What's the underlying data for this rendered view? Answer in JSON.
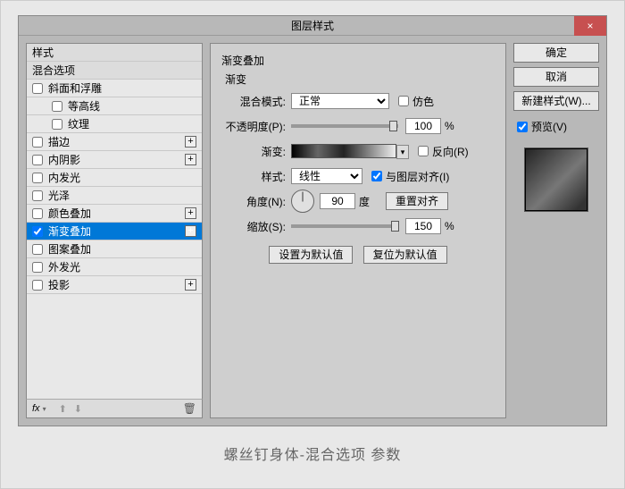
{
  "window": {
    "title": "图层样式",
    "close": "×"
  },
  "sidebar": {
    "rows": [
      {
        "label": "样式",
        "header": true
      },
      {
        "label": "混合选项",
        "header": true
      },
      {
        "label": "斜面和浮雕",
        "cb": true
      },
      {
        "label": "等高线",
        "cb": true,
        "indent": true
      },
      {
        "label": "纹理",
        "cb": true,
        "indent": true
      },
      {
        "label": "描边",
        "cb": true,
        "plus": true
      },
      {
        "label": "内阴影",
        "cb": true,
        "plus": true
      },
      {
        "label": "内发光",
        "cb": true
      },
      {
        "label": "光泽",
        "cb": true
      },
      {
        "label": "颜色叠加",
        "cb": true,
        "plus": true
      },
      {
        "label": "渐变叠加",
        "cb": true,
        "plus": true,
        "selected": true,
        "checked": true
      },
      {
        "label": "图案叠加",
        "cb": true
      },
      {
        "label": "外发光",
        "cb": true
      },
      {
        "label": "投影",
        "cb": true,
        "plus": true
      }
    ],
    "footer": {
      "fx": "fx",
      "up": "⬆",
      "down": "⬇",
      "trash": "🗑"
    }
  },
  "panel": {
    "title": "渐变叠加",
    "subtitle": "渐变",
    "labels": {
      "blend": "混合模式:",
      "opacity": "不透明度(P):",
      "gradient": "渐变:",
      "style": "样式:",
      "angle": "角度(N):",
      "scale": "缩放(S):"
    },
    "values": {
      "blend": "正常",
      "opacity": "100",
      "style": "线性",
      "angle": "90",
      "scale": "150"
    },
    "checkboxes": {
      "dither": "仿色",
      "reverse": "反向(R)",
      "align": "与图层对齐(I)"
    },
    "degree": "度",
    "percent": "%",
    "reset_align": "重置对齐",
    "btn_default": "设置为默认值",
    "btn_reset": "复位为默认值"
  },
  "right": {
    "ok": "确定",
    "cancel": "取消",
    "new_style": "新建样式(W)...",
    "preview": "预览(V)"
  },
  "caption": "螺丝钉身体-混合选项 参数"
}
